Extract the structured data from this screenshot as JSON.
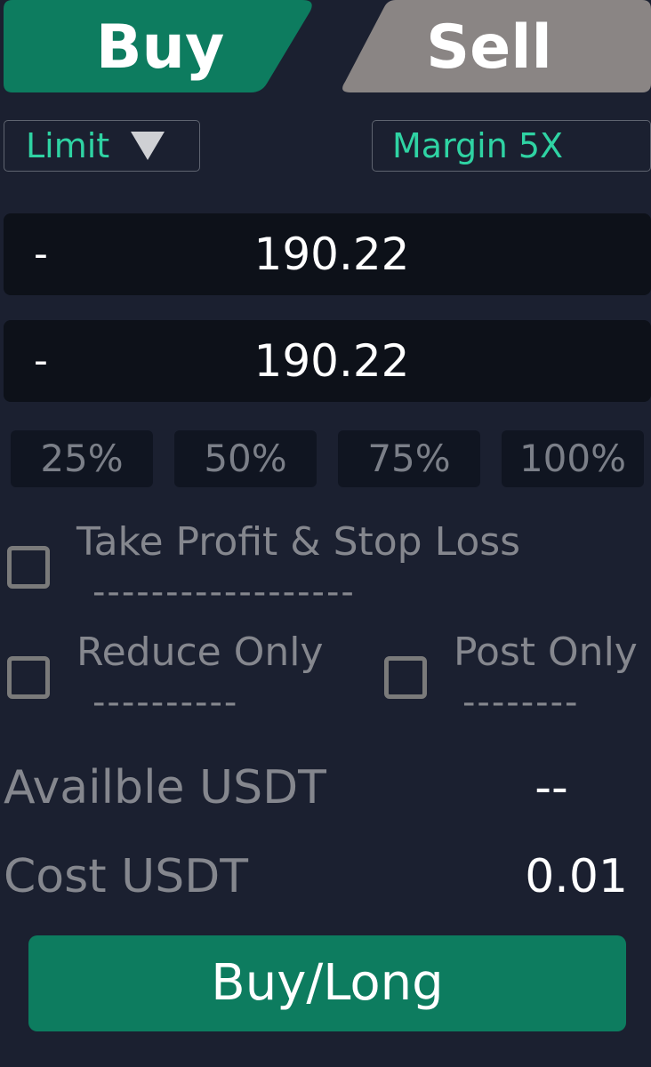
{
  "tabs": {
    "buy": "Buy",
    "sell": "Sell"
  },
  "order_type": {
    "value": "Limit"
  },
  "margin": {
    "label": "Margin 5X"
  },
  "price_input": {
    "decrement": "-",
    "value": "190.22"
  },
  "amount_input": {
    "decrement": "-",
    "value": "190.22"
  },
  "percent_buttons": [
    "25%",
    "50%",
    "75%",
    "100%"
  ],
  "options": {
    "tpsl": {
      "label": "Take Profit & Stop Loss",
      "underline": "------------------"
    },
    "reduce_only": {
      "label": "Reduce Only",
      "underline": "----------"
    },
    "post_only": {
      "label": "Post Only",
      "underline": "--------"
    }
  },
  "available": {
    "label": "Availble USDT",
    "value": "--"
  },
  "cost": {
    "label": "Cost USDT",
    "value": "0.01"
  },
  "submit": {
    "label": "Buy/Long"
  },
  "colors": {
    "background": "#1b2030",
    "buy_green": "#0d7c5f",
    "sell_gray": "#8a8584",
    "accent_teal": "#2fd3a3",
    "input_bg": "#0d1119"
  }
}
